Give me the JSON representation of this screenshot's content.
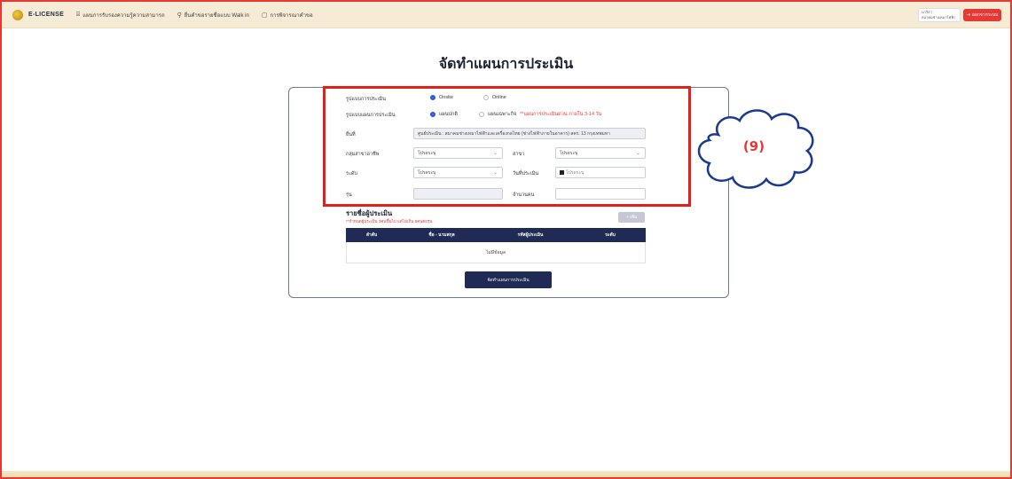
{
  "app": {
    "brand": "E-LICENSE"
  },
  "nav": [
    {
      "icon": "clipboard-icon",
      "glyph": "⌸",
      "label": "แผนการรับรองความรู้ความสามารถ"
    },
    {
      "icon": "walk-in-icon",
      "glyph": "⚲",
      "label": "ยื่นคำขอรายชื่อแบบ Walk in"
    },
    {
      "icon": "document-icon",
      "glyph": "▢",
      "label": "การพิจารณาคำขอ"
    }
  ],
  "user": {
    "line1": "นาริสา",
    "line2": "สมาคมช่างเหมาไฟฟ้าและ..."
  },
  "logout_label": "ออกจากระบบ",
  "page_title": "จัดทำแผนการประเมิน",
  "form": {
    "mode_label": "รูปแบบการประเมิน",
    "mode_options": [
      "Onsite",
      "Online"
    ],
    "mode_selected": 0,
    "plan_label": "รูปแบบแผนการประเมิน",
    "plan_options": [
      "แผนปกติ",
      "แผนเฉพาะกิจ"
    ],
    "plan_selected": 0,
    "plan_warning": "**แผนการประเมินด่วน ภายใน 3-14 วัน",
    "location_label": "ยื่นที่",
    "location_value": "ศูนย์ประเมิน : สมาคมช่างเหมาไฟฟ้าและเครื่องกลไทย (ช่างไฟฟ้าภายในอาคาร) สคร. 13 กรุงเทพมหา",
    "group_label": "กลุ่มสาขาอาชีพ",
    "group_value": "โปรดระบุ",
    "branch_label": "สาขา",
    "branch_value": "โปรดระบุ",
    "level_label": "ระดับ",
    "level_value": "โปรดระบุ",
    "date_label": "วันที่ประเมิน",
    "date_placeholder": "โปรดระบุ",
    "batch_label": "รุ่น",
    "count_label": "จำนวนคน"
  },
  "annotation": {
    "label": "(9)",
    "highlight_color": "#e0201b"
  },
  "assessors": {
    "title": "รายชื่อผู้ประเมิน",
    "note": "**กำหนดผู้ประเมิน 3คนขึ้นไป แต่ไม่เกิน 5คนต่อรุ่น",
    "add_label": "+ เพิ่ม",
    "columns": [
      "ลำดับ",
      "ชื่อ - นามสกุล",
      "รหัสผู้ประเมิน",
      "ระดับ"
    ],
    "empty": "ไม่มีข้อมูล"
  },
  "submit_label": "จัดทำแผนการประเมิน"
}
